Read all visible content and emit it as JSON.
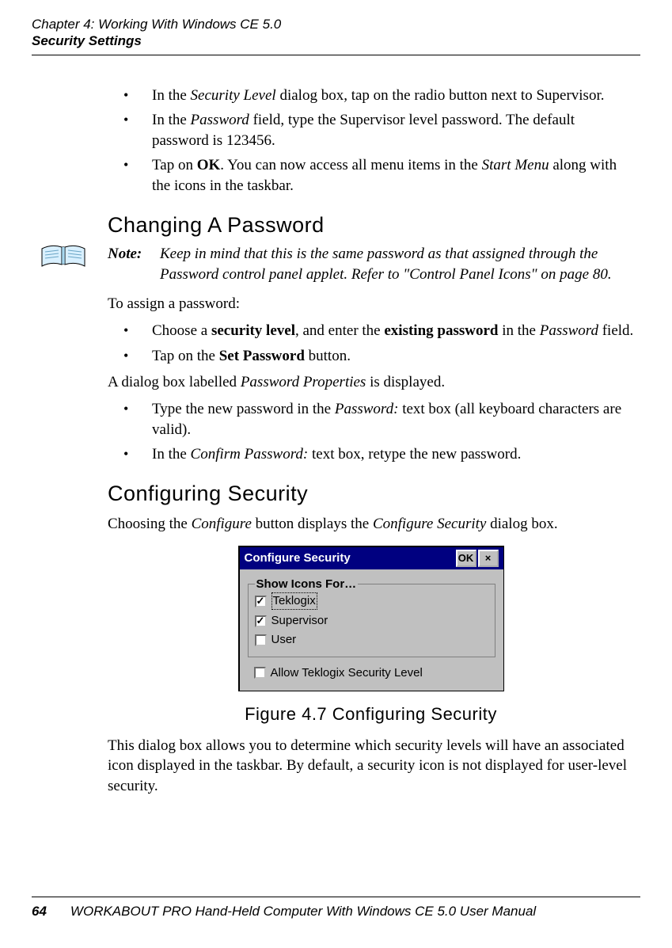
{
  "header": {
    "line1": "Chapter 4: Working With Windows CE 5.0",
    "line2": "Security Settings"
  },
  "intro_bullets": {
    "b1_pre": "In the ",
    "b1_em": "Security Level",
    "b1_post": " dialog box, tap on the radio button next to Supervisor.",
    "b2_pre": "In the ",
    "b2_em": "Password",
    "b2_post": " field, type the Supervisor level password. The default password is 123456.",
    "b3_pre": "Tap on ",
    "b3_bold": "OK",
    "b3_mid": ". You can now access all menu items in the ",
    "b3_em": "Start Menu",
    "b3_post": " along with the icons in the taskbar."
  },
  "section1": {
    "title": "Changing A Password",
    "note_label": "Note:",
    "note_text": "Keep in mind that this is the same password as that assigned through the Password control panel applet. Refer to \"Control Panel Icons\" on page 80.",
    "p1": "To assign a password:",
    "bul1_pre": "Choose a ",
    "bul1_b1": "security level",
    "bul1_mid": ", and enter the ",
    "bul1_b2": "existing password",
    "bul1_mid2": " in the ",
    "bul1_em": "Password",
    "bul1_post": " field.",
    "bul2_pre": "Tap on the ",
    "bul2_b": "Set Password",
    "bul2_post": " button.",
    "p2_pre": "A dialog box labelled ",
    "p2_em": "Password Properties",
    "p2_post": " is displayed.",
    "bul3_pre": "Type the new password in the ",
    "bul3_em": "Password:",
    "bul3_post": " text box (all keyboard characters are valid).",
    "bul4_pre": "In the ",
    "bul4_em": "Confirm Password:",
    "bul4_post": " text box, retype the new password."
  },
  "section2": {
    "title": "Configuring Security",
    "p1_pre": "Choosing the ",
    "p1_em1": "Configure",
    "p1_mid": " button displays the ",
    "p1_em2": "Configure Security",
    "p1_post": " dialog box.",
    "caption": "Figure 4.7 Configuring Security",
    "p2": "This dialog box allows you to determine which security levels will have an associated icon displayed in the taskbar. By default, a security icon is not displayed for user-level security."
  },
  "dialog": {
    "title": "Configure Security",
    "ok": "OK",
    "close": "×",
    "group_title": "Show Icons For…",
    "opt1": "Teklogix",
    "opt2": "Supervisor",
    "opt3": "User",
    "allow": "Allow Teklogix Security Level"
  },
  "footer": {
    "page": "64",
    "title": "WORKABOUT PRO Hand-Held Computer With Windows CE 5.0 User Manual"
  }
}
